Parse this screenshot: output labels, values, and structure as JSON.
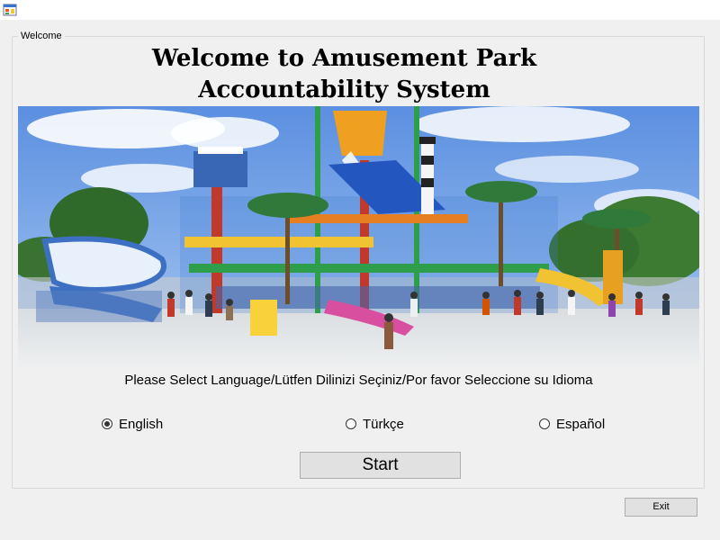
{
  "app_icon": "windows-form-icon",
  "groupbox": {
    "caption": "Welcome"
  },
  "heading": {
    "line1": "Welcome to Amusement Park",
    "line2": "Accountability System"
  },
  "picture": {
    "icon": "water-park-photo"
  },
  "language": {
    "prompt": "Please Select Language/Lütfen Dilinizi Seçiniz/Por favor Seleccione su Idioma",
    "options": [
      {
        "label": "English",
        "checked": true
      },
      {
        "label": "Türkçe",
        "checked": false
      },
      {
        "label": "Español",
        "checked": false
      }
    ]
  },
  "buttons": {
    "start": "Start",
    "exit": "Exit"
  }
}
